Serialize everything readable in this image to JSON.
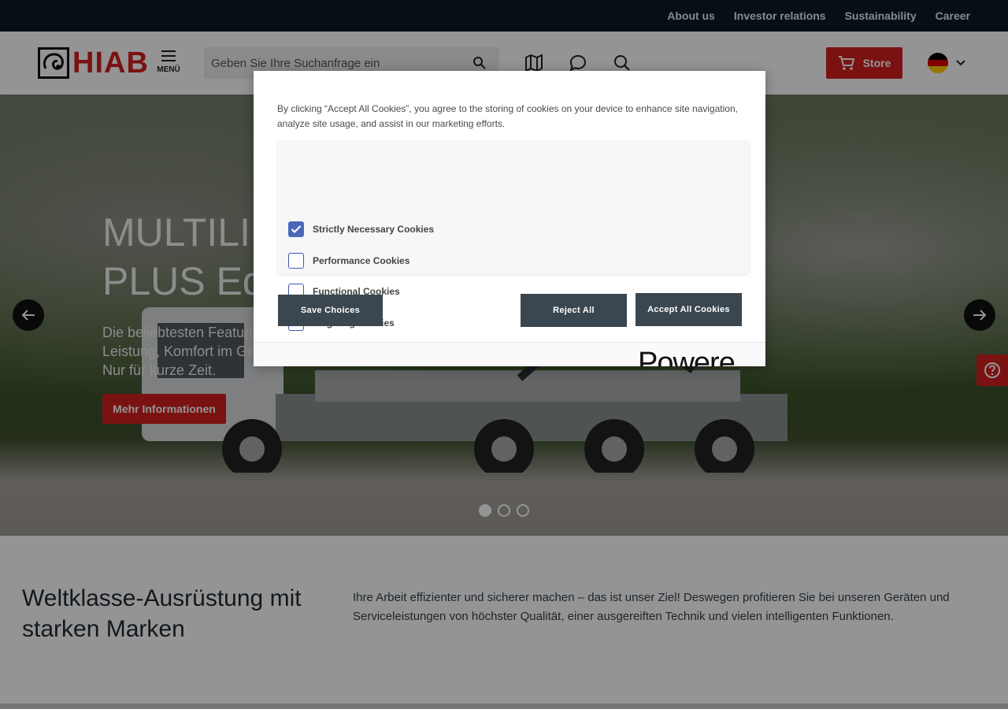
{
  "topbar": {
    "links": [
      "About us",
      "Investor relations",
      "Sustainability",
      "Career"
    ]
  },
  "header": {
    "logo_text": "HIAB",
    "menu_label": "MENÜ",
    "search_placeholder": "Geben Sie Ihre Suchanfrage ein",
    "store_label": "Store",
    "icons": [
      "map-icon",
      "chat-icon",
      "search-icon"
    ],
    "language": "de"
  },
  "hero": {
    "title_line1": "MULTILIFT",
    "title_line2": "PLUS Edition",
    "text": "Die beliebtesten Features – mehr Leistung, Komfort im Gesamtpaket. Nur für kurze Zeit.",
    "cta": "Mehr Informationen",
    "slides_total": 3,
    "active_slide": 1
  },
  "section": {
    "heading": "Weltklasse-Ausrüstung mit starken Marken",
    "body": "Ihre Arbeit effizienter und sicherer machen – das ist unser Ziel! Deswegen profitieren Sie bei unseren Geräten und Serviceleistungen von höchster Qualität, einer ausgereiften Technik und vielen intelligenten Funktionen."
  },
  "cookie_dialog": {
    "intro": "By clicking “Accept All Cookies”, you agree to the storing of cookies on your device to enhance site navigation, analyze site usage, and assist in our marketing efforts.",
    "preferences": [
      {
        "label": "Strictly Necessary Cookies",
        "checked": true
      },
      {
        "label": "Performance Cookies",
        "checked": false
      },
      {
        "label": "Functional Cookies",
        "checked": false
      },
      {
        "label": "Targeting Cookies",
        "checked": false
      }
    ],
    "save_label": "Save Choices",
    "reject_label": "Reject All",
    "accept_label": "Accept All Cookies",
    "powered_by": "Powere"
  },
  "colors": {
    "brand_red": "#d4201f",
    "topbar": "#0d1b26",
    "button_dark": "#3a4750",
    "checkbox_blue": "#4a68b8"
  }
}
